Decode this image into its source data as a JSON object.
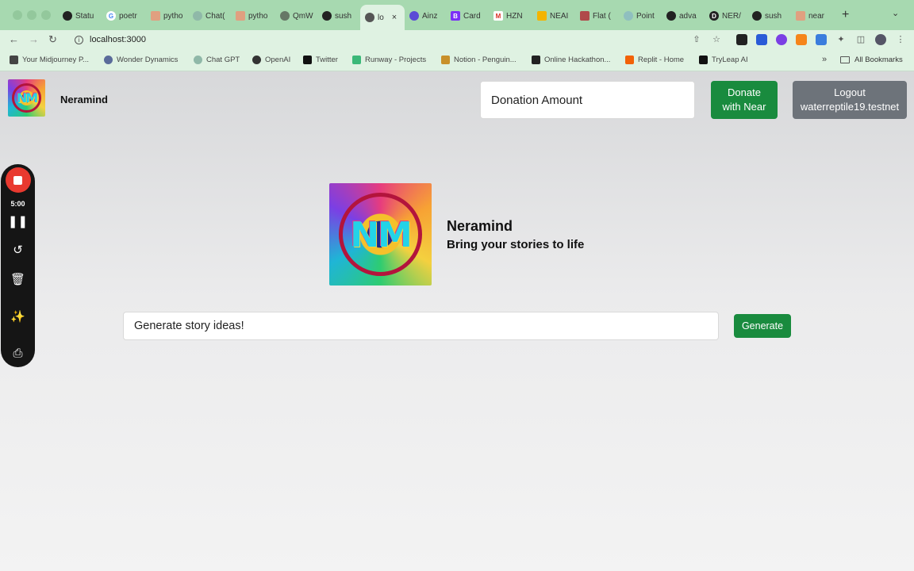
{
  "browser": {
    "tabs": [
      {
        "label": "Statu",
        "icon": "github-icon",
        "color": "#222222"
      },
      {
        "label": "poetr",
        "icon": "google-icon",
        "color": "#ffffff"
      },
      {
        "label": "pytho",
        "icon": "page-icon",
        "color": "#e0a080"
      },
      {
        "label": "Chat(",
        "icon": "chatgpt-icon",
        "color": "#8fb8a8"
      },
      {
        "label": "pytho",
        "icon": "page-icon",
        "color": "#e0a080"
      },
      {
        "label": "QmW",
        "icon": "globe-icon",
        "color": "#667766"
      },
      {
        "label": "sush",
        "icon": "github-icon",
        "color": "#222222"
      },
      {
        "label": "lo",
        "icon": "globe-icon",
        "color": "#555555"
      },
      {
        "label": "Ainz",
        "icon": "circle-icon",
        "color": "#5b4bd6"
      },
      {
        "label": "Card",
        "icon": "bootstrap-icon",
        "color": "#7b2ff7"
      },
      {
        "label": "HZN",
        "icon": "gmail-icon",
        "color": "#d93025"
      },
      {
        "label": "NEAI",
        "icon": "note-icon",
        "color": "#f4b400"
      },
      {
        "label": "Flat (",
        "icon": "photo-icon",
        "color": "#b04a4a"
      },
      {
        "label": "Point",
        "icon": "circle-icon",
        "color": "#8fbfbf"
      },
      {
        "label": "adva",
        "icon": "github-icon",
        "color": "#222222"
      },
      {
        "label": "NER/",
        "icon": "d-icon",
        "color": "#222222"
      },
      {
        "label": "sush",
        "icon": "github-icon",
        "color": "#222222"
      },
      {
        "label": "near",
        "icon": "page-icon",
        "color": "#e0a080"
      }
    ],
    "active_tab_close": "×",
    "new_tab": "+",
    "url": "localhost:3000",
    "bookmarks": [
      {
        "label": "Your Midjourney P...",
        "color": "#444444"
      },
      {
        "label": "Wonder Dynamics",
        "color": "#5a6b9a"
      },
      {
        "label": "Chat GPT",
        "color": "#8fb8a8"
      },
      {
        "label": "OpenAI",
        "color": "#333333"
      },
      {
        "label": "Twitter",
        "color": "#111111"
      },
      {
        "label": "Runway - Projects",
        "color": "#3bb878"
      },
      {
        "label": "Notion - Penguin...",
        "color": "#c8902a"
      },
      {
        "label": "Online Hackathon...",
        "color": "#222222"
      },
      {
        "label": "Replit - Home",
        "color": "#f26207"
      },
      {
        "label": "TryLeap AI",
        "color": "#111111"
      }
    ],
    "all_bookmarks": "All Bookmarks"
  },
  "header": {
    "brand": "Neramind",
    "donation_placeholder": "Donation Amount",
    "donate_line1": "Donate",
    "donate_line2": "with Near",
    "logout_line1": "Logout",
    "logout_line2": "waterreptile19.testnet"
  },
  "recorder": {
    "time": "5:00"
  },
  "hero": {
    "title": "Neramind",
    "subtitle": "Bring your stories to life",
    "logo_text": "NM"
  },
  "prompt": {
    "placeholder": "Generate story ideas!",
    "button": "Generate"
  },
  "colors": {
    "accent_green": "#198b3e",
    "logout_gray": "#6d737a",
    "tabstrip": "#a7d9b0",
    "record_red": "#e9392f"
  }
}
